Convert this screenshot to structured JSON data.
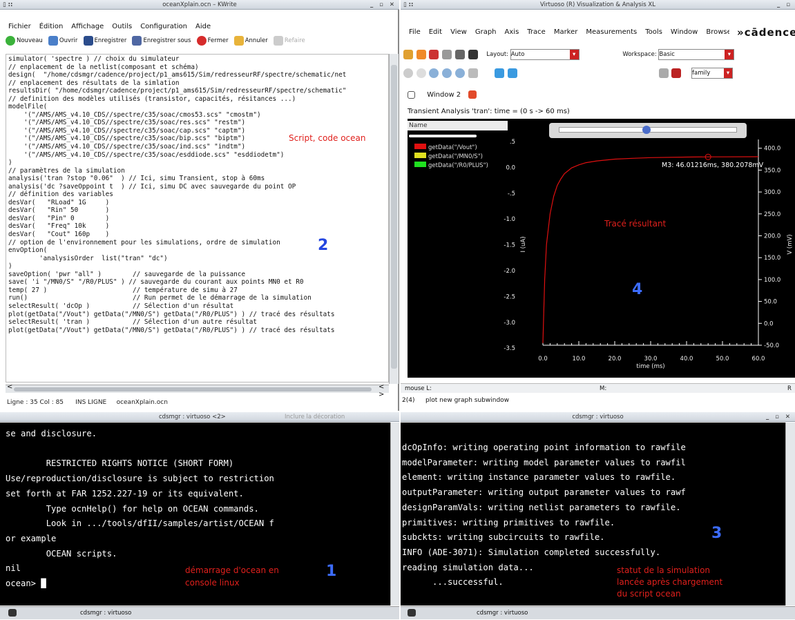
{
  "left_window": {
    "title": "oceanXplain.ocn – KWrite",
    "menu": [
      "Fichier",
      "Édition",
      "Affichage",
      "Outils",
      "Configuration",
      "Aide"
    ],
    "toolbar": {
      "new": "Nouveau",
      "open": "Ouvrir",
      "save": "Enregistrer",
      "save_as": "Enregistrer sous",
      "close": "Fermer",
      "undo": "Annuler",
      "redo": "Refaire"
    },
    "code_lines": [
      "simulator( 'spectre ) // choix du simulateur",
      "// enplacement de la netlist(composant et schéma)",
      "design(  \"/home/cdsmgr/cadence/project/p1_ams615/Sim/redresseurRF/spectre/schematic/net",
      "// enplacement des résultats de la simlation",
      "resultsDir( \"/home/cdsmgr/cadence/project/p1_ams615/Sim/redresseurRF/spectre/schematic\"",
      "// definition des modèles utilisés (transistor, capacités, résitances ...)",
      "modelFile(",
      "    '(\"/AMS/AMS_v4.10_CDS//spectre/c35/soac/cmos53.scs\" \"cmostm\")",
      "    '(\"/AMS/AMS_v4.10_CDS//spectre/c35/soac/res.scs\" \"restm\")",
      "    '(\"/AMS/AMS_v4.10_CDS//spectre/c35/soac/cap.scs\" \"captm\")",
      "    '(\"/AMS/AMS_v4.10_CDS//spectre/c35/soac/bip.scs\" \"biptm\")",
      "    '(\"/AMS/AMS_v4.10_CDS//spectre/c35/soac/ind.scs\" \"indtm\")",
      "    '(\"/AMS/AMS_v4.10_CDS//spectre/c35/soac/esddiode.scs\" \"esddiodetm\")",
      ")",
      "// paramètres de la simulation",
      "analysis('tran ?stop \"0.06\"  ) // Ici, simu Transient, stop à 60ms",
      "analysis('dc ?saveOppoint t  ) // Ici, simu DC avec sauvegarde du point OP",
      "// définition des variables",
      "desVar(   \"RLoad\" 1G     )",
      "desVar(   \"Rin\" 50       )",
      "desVar(   \"Pin\" 0        )",
      "desVar(   \"Freq\" 10k     )",
      "desVar(   \"Cout\" 160p    )",
      "// option de l'environnement pour les simulations, ordre de simulation",
      "envOption(",
      "        'analysisOrder  list(\"tran\" \"dc\")",
      ")",
      "saveOption( 'pwr \"all\" )        // sauvegarde de la puissance",
      "save( 'i \"/MN0/S\" \"/R0/PLUS\" ) // sauvegarde du courant aux points MN0 et R0",
      "temp( 27 )                      // température de simu à 27",
      "run()                           // Run permet de le démarrage de la simulation",
      "selectResult( 'dcOp )           // Sélection d'un résultat",
      "plot(getData(\"/Vout\") getData(\"/MN0/S\") getData(\"/R0/PLUS\") ) // tracé des résultats",
      "selectResult( 'tran )           // Sélection d'un autre résultat",
      "plot(getData(\"/Vout\") getData(\"/MN0/S\") getData(\"/R0/PLUS\") ) // tracé des résultats"
    ],
    "annotation_script": "Script, code ocean",
    "annotation_number": "2",
    "status": {
      "line_col": "Ligne : 35 Col : 85",
      "mode": "INS  LIGNE",
      "file": "oceanXplain.ocn"
    }
  },
  "right_window": {
    "title": "Virtuoso (R) Visualization & Analysis XL",
    "menu": [
      "File",
      "Edit",
      "View",
      "Graph",
      "Axis",
      "Trace",
      "Marker",
      "Measurements",
      "Tools",
      "Window",
      "Browser"
    ],
    "brand": "»cādence",
    "layout_label": "Layout:",
    "layout_value": "Auto",
    "workspace_label": "Workspace:",
    "workspace_value": "Basic",
    "family_value": "family",
    "tab": "Window 2",
    "analysis_title": "Transient Analysis 'tran': time = (0 s -> 60 ms)",
    "name_header": "Name",
    "marker_label": "M3: 46.01216ms, 380.2078mV",
    "annotation_plot": "Tracé résultant",
    "annotation_number": "4",
    "mouse_label": "mouse L:",
    "m_label": "M:",
    "r_label": "R",
    "cmd_index": "2(4)",
    "cmd_text": "plot new graph subwindow"
  },
  "chart_data": {
    "type": "line",
    "title": "Transient Analysis 'tran': time = (0 s -> 60 ms)",
    "xlabel": "time (ms)",
    "ylabel_left": "I (uA)",
    "ylabel_right": "V (mV)",
    "x_ticks": [
      "0.0",
      "10.0",
      "20.0",
      "30.0",
      "40.0",
      "50.0",
      "60.0"
    ],
    "y_left_ticks": [
      ".5",
      "0.0",
      "-.5",
      "-1.0",
      "-1.5",
      "-2.0",
      "-2.5",
      "-3.0",
      "-3.5"
    ],
    "y_right_ticks": [
      "400.0",
      "350.0",
      "300.0",
      "250.0",
      "200.0",
      "150.0",
      "100.0",
      "50.0",
      "0.0",
      "-50.0"
    ],
    "xlim": [
      0,
      60
    ],
    "ylim_right": [
      -50,
      420
    ],
    "series": [
      {
        "name": "getData(\"/Vout\")",
        "color": "#e01010",
        "x": [
          0,
          0.5,
          1,
          2,
          3,
          4,
          5,
          6,
          8,
          10,
          12,
          15,
          20,
          25,
          30,
          40,
          46,
          50,
          60
        ],
        "values": [
          -45,
          100,
          180,
          250,
          290,
          315,
          330,
          342,
          355,
          362,
          367,
          371,
          375,
          377,
          378.5,
          379.8,
          380.2,
          380.3,
          380.5
        ]
      },
      {
        "name": "getData(\"/MN0/S\")",
        "color": "#e0e020"
      },
      {
        "name": "getData(\"/R0/PLUS\")",
        "color": "#20e020"
      }
    ],
    "legend": "top-left"
  },
  "terminal_left": {
    "title": "cdsmgr : virtuoso <2>",
    "inclure": "Inclure la décoration",
    "lines": [
      "se and disclosure.",
      "",
      "        RESTRICTED RIGHTS NOTICE (SHORT FORM)",
      "Use/reproduction/disclosure is subject to restriction",
      "set forth at FAR 1252.227-19 or its equivalent.",
      "        Type ocnHelp() for help on OCEAN commands.",
      "        Look in .../tools/dfII/samples/artist/OCEAN f",
      "or example",
      "        OCEAN scripts.",
      "nil",
      "ocean> █"
    ],
    "annotation": "démarrage d'ocean en\nconsole linux",
    "annotation_number": "1",
    "taskbar": "cdsmgr : virtuoso"
  },
  "terminal_right": {
    "title": "cdsmgr : virtuoso",
    "lines": [
      "dcOpInfo: writing operating point information to rawfile",
      "modelParameter: writing model parameter values to rawfil",
      "element: writing instance parameter values to rawfile.",
      "outputParameter: writing output parameter values to rawf",
      "designParamVals: writing netlist parameters to rawfile.",
      "primitives: writing primitives to rawfile.",
      "subckts: writing subcircuits to rawfile.",
      "INFO (ADE-3071): Simulation completed successfully.",
      "reading simulation data...",
      "      ...successful."
    ],
    "annotation": "statut de la simulation\nlancée après chargement\ndu script ocean",
    "annotation_number": "3",
    "taskbar": "cdsmgr : virtuoso"
  }
}
